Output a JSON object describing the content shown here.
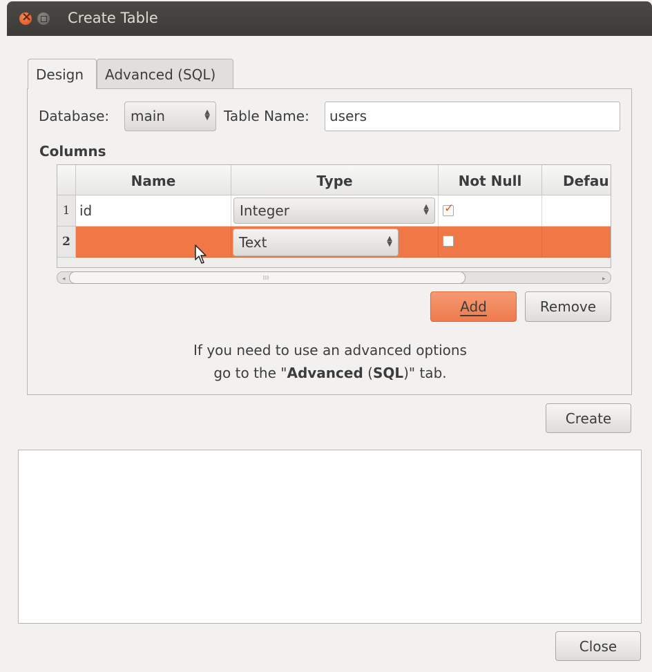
{
  "window": {
    "title": "Create Table"
  },
  "tabs": [
    {
      "label": "Design",
      "active": true
    },
    {
      "label": "Advanced (SQL)",
      "active": false
    }
  ],
  "form": {
    "database_label": "Database:",
    "database_value": "main",
    "table_name_label": "Table Name:",
    "table_name_value": "users",
    "columns_label": "Columns"
  },
  "columns_table": {
    "headers": [
      "Name",
      "Type",
      "Not Null",
      "Defau"
    ],
    "rows": [
      {
        "num": "1",
        "name": "id",
        "type": "Integer",
        "not_null": true,
        "default": ""
      },
      {
        "num": "2",
        "name": "",
        "type": "Text",
        "not_null": false,
        "default": "",
        "selected": true
      }
    ]
  },
  "buttons": {
    "add": "Add",
    "remove": "Remove",
    "create": "Create",
    "close": "Close"
  },
  "info": {
    "line1": "If you need to use an advanced options",
    "line2_pre": "go to the \"",
    "line2_b1": "Advanced",
    "line2_mid": " (",
    "line2_b2": "SQL",
    "line2_post": ")\" tab."
  },
  "colors": {
    "accent": "#f07746",
    "titlebar": "#3c3b37"
  }
}
